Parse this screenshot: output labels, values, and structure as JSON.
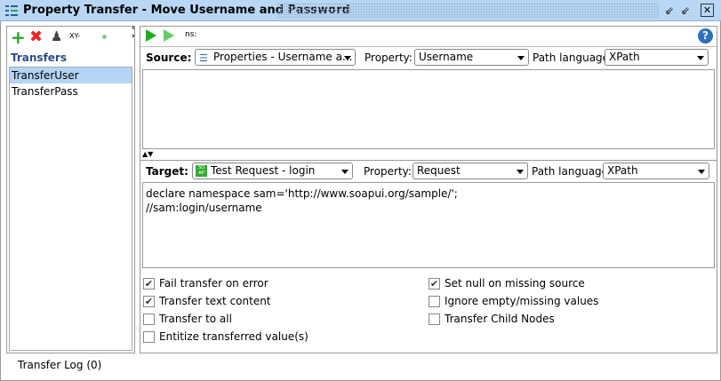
{
  "window": {
    "title": "Property Transfer - Move Username and Password"
  },
  "left_toolbar": {
    "xy_label": "XY-"
  },
  "transfers": {
    "header": "Transfers",
    "items": [
      {
        "label": "TransferUser",
        "selected": true
      },
      {
        "label": "TransferPass",
        "selected": false
      }
    ]
  },
  "toolbar": {
    "ns_label": "ns:"
  },
  "source": {
    "label": "Source:",
    "value": "Properties - Username a...",
    "property_label": "Property:",
    "property_value": "Username",
    "path_label": "Path language:",
    "path_value": "XPath",
    "expression": ""
  },
  "target": {
    "label": "Target:",
    "value": "Test Request - login",
    "property_label": "Property:",
    "property_value": "Request",
    "path_label": "Path language:",
    "path_value": "XPath",
    "expression_lines": [
      "declare namespace sam='http://www.soapui.org/sample/';",
      "//sam:login/username"
    ]
  },
  "options": [
    {
      "label": "Fail transfer on error",
      "checked": true
    },
    {
      "label": "Transfer text content",
      "checked": true
    },
    {
      "label": "Transfer to all",
      "checked": false
    },
    {
      "label": "Entitize transferred value(s)",
      "checked": false
    },
    {
      "label": "Set null on missing source",
      "checked": true
    },
    {
      "label": "Ignore empty/missing values",
      "checked": false
    },
    {
      "label": "Transfer Child Nodes",
      "checked": false
    }
  ],
  "footer": {
    "log_tab": "Transfer Log (0)"
  }
}
